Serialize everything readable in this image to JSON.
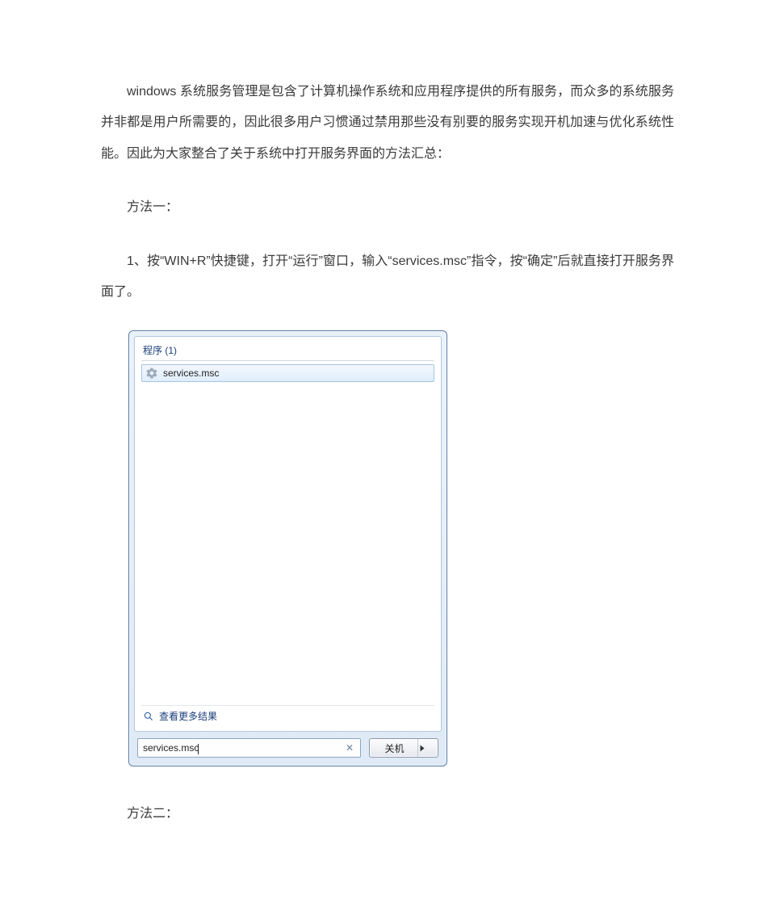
{
  "article": {
    "intro": "windows 系统服务管理是包含了计算机操作系统和应用程序提供的所有服务，而众多的系统服务并非都是用户所需要的，因此很多用户习惯通过禁用那些没有别要的服务实现开机加速与优化系统性能。因此为大家整合了关于系统中打开服务界面的方法汇总：",
    "method1_title": "方法一：",
    "method1_step": "1、按“WIN+R”快捷键，打开“运行”窗口，输入“services.msc”指令，按“确定”后就直接打开服务界面了。",
    "method2_title": "方法二："
  },
  "win7": {
    "header": "程序 (1)",
    "result_label": "services.msc",
    "more_results": "查看更多结果",
    "search_value": "services.msc",
    "shutdown_label": "关机"
  }
}
